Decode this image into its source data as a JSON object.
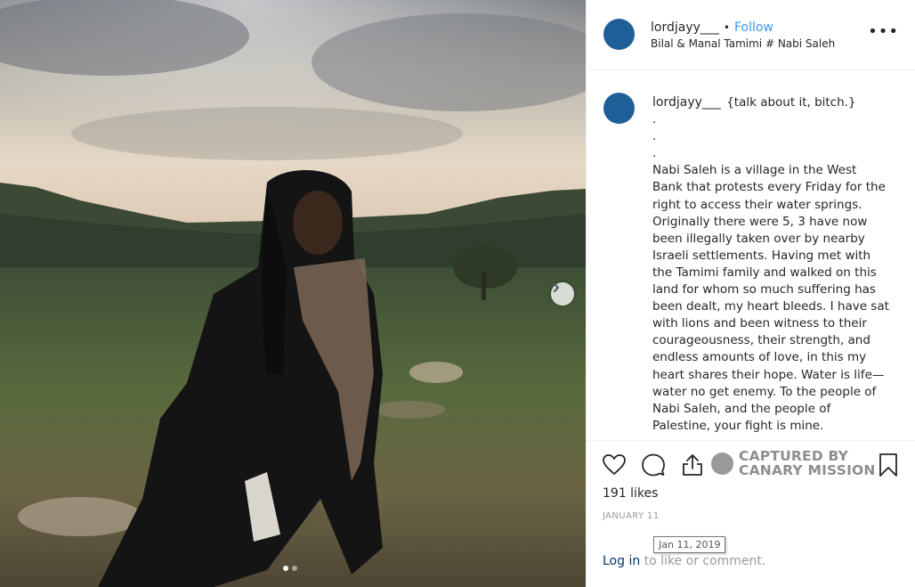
{
  "post": {
    "username": "lordjayy___",
    "separator": "•",
    "follow_label": "Follow",
    "location": "Bilal & Manal Tamimi # Nabi Saleh",
    "more_icon": "more-options-icon",
    "more_label": "•••"
  },
  "caption": {
    "username": "lordjayy___",
    "lines": [
      "{talk about it, bitch.}",
      ".",
      ".",
      ".",
      "Nabi Saleh is a village in the West",
      "Bank that protests every Friday for the",
      "right to access their water springs.",
      "Originally there were 5, 3 have now",
      "been illegally taken over by nearby",
      "Israeli settlements. Having met with",
      "the Tamimi family and walked on this",
      "land for whom so much suffering has",
      "been dealt, my heart bleeds. I have sat",
      "with lions and been witness to their",
      "courageousness, their strength, and",
      "endless amounts of love, in this my",
      "heart shares their hope. Water is life—",
      "water no get enemy. To the people of",
      "Nabi Saleh, and the people of",
      "Palestine, your fight is mine."
    ]
  },
  "actions": {
    "like_icon": "heart-icon",
    "comment_icon": "comment-icon",
    "share_icon": "share-icon",
    "save_icon": "bookmark-icon",
    "watermark_line1": "CAPTURED BY",
    "watermark_line2": "CANARY MISSION"
  },
  "stats": {
    "likes": "191 likes",
    "date": "JANUARY 11",
    "tooltip": "Jan 11, 2019"
  },
  "login": {
    "link": "Log in",
    "rest": " to like or comment."
  },
  "carousel": {
    "next_icon": "chevron-right-icon",
    "slide_count": 2,
    "active_slide": 1
  },
  "colors": {
    "avatar": "#1f5f98",
    "follow": "#3897f0",
    "link": "#003569"
  }
}
